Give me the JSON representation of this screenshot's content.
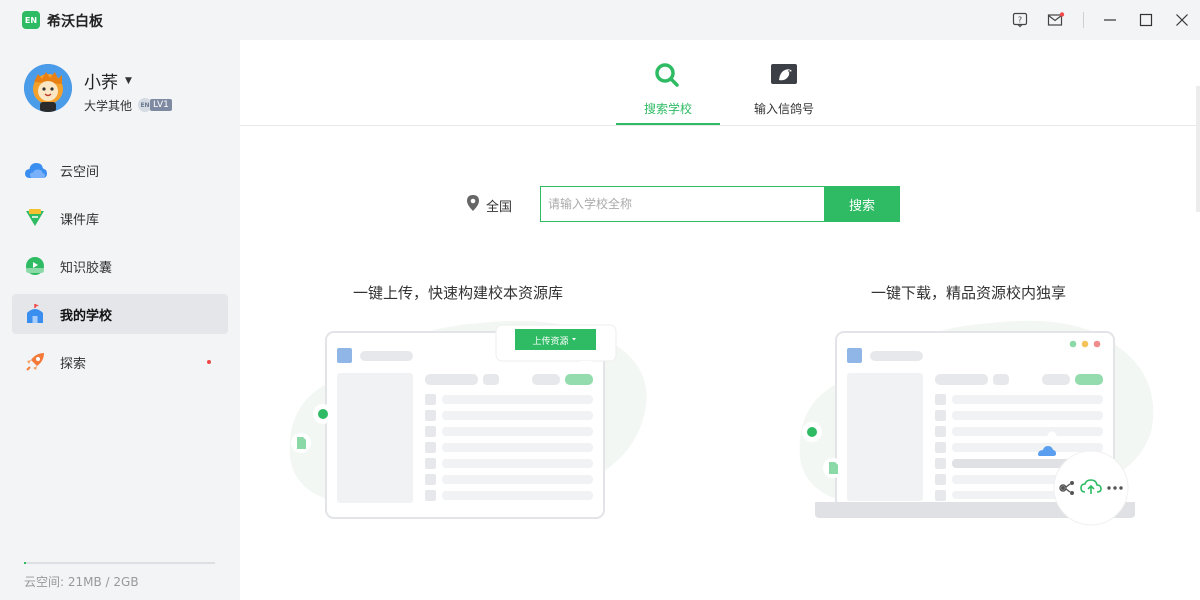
{
  "window": {
    "logo_text": "EN",
    "title": "希沃白板",
    "controls": [
      "help-icon",
      "mail-icon",
      "minimize-icon",
      "maximize-icon",
      "close-icon"
    ]
  },
  "user": {
    "name": "小荞",
    "org": "大学其他",
    "badge_en": "EN",
    "level": "LV1"
  },
  "sidebar": {
    "items": [
      {
        "label": "云空间",
        "icon": "cloud-icon"
      },
      {
        "label": "课件库",
        "icon": "courseware-icon"
      },
      {
        "label": "知识胶囊",
        "icon": "capsule-icon"
      },
      {
        "label": "我的学校",
        "icon": "school-icon",
        "active": true
      },
      {
        "label": "探索",
        "icon": "rocket-icon",
        "has_dot": true
      }
    ],
    "storage": {
      "text": "云空间:  21MB / 2GB",
      "used_fraction": 0.01
    }
  },
  "tabs": [
    {
      "label": "搜索学校",
      "icon": "search-icon",
      "active": true
    },
    {
      "label": "输入信鸽号",
      "icon": "pigeon-icon",
      "active": false
    }
  ],
  "search": {
    "region": "全国",
    "placeholder": "请输入学校全称",
    "button": "搜索"
  },
  "features": {
    "upload": {
      "title": "一键上传，快速构建校本资源库",
      "button": "上传资源"
    },
    "download": {
      "title": "一键下载，精品资源校内独享"
    }
  },
  "colors": {
    "brand": "#2fbb64",
    "sidebar_bg": "#f3f4f6",
    "active_item_bg": "#e4e6ea"
  }
}
